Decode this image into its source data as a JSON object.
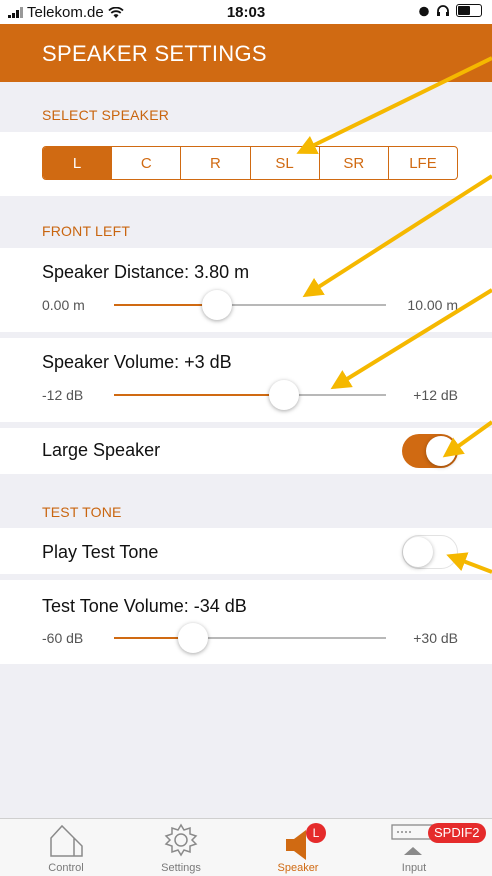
{
  "status_bar": {
    "carrier": "Telekom.de",
    "time": "18:03"
  },
  "nav": {
    "title": "SPEAKER SETTINGS"
  },
  "select_speaker": {
    "header": "SELECT SPEAKER",
    "segments": [
      "L",
      "C",
      "R",
      "SL",
      "SR",
      "LFE"
    ],
    "selected": "L"
  },
  "front_left": {
    "header": "FRONT LEFT",
    "distance": {
      "label": "Speaker Distance:",
      "value": "3.80 m",
      "min": "0.00 m",
      "max": "10.00 m",
      "fraction": 0.38
    },
    "volume": {
      "label": "Speaker Volume:",
      "value": "+3 dB",
      "min": "-12 dB",
      "max": "+12 dB",
      "fraction": 0.625
    },
    "large_speaker": {
      "label": "Large Speaker",
      "on": true
    }
  },
  "test_tone": {
    "header": "TEST TONE",
    "play": {
      "label": "Play Test Tone",
      "on": false
    },
    "volume": {
      "label": "Test Tone Volume:",
      "value": "-34 dB",
      "min": "-60 dB",
      "max": "+30 dB",
      "fraction": 0.289
    }
  },
  "tab_bar": {
    "tabs": [
      {
        "label": "Control",
        "icon": "house-icon"
      },
      {
        "label": "Settings",
        "icon": "gear-icon"
      },
      {
        "label": "Speaker",
        "icon": "speaker-icon",
        "badge": "L"
      },
      {
        "label": "Input",
        "icon": "input-icon",
        "badge": "SPDIF2"
      }
    ],
    "active": "Speaker"
  },
  "colors": {
    "accent": "#d06a12",
    "annotation_arrow": "#f5b800",
    "background": "#efeff4"
  }
}
